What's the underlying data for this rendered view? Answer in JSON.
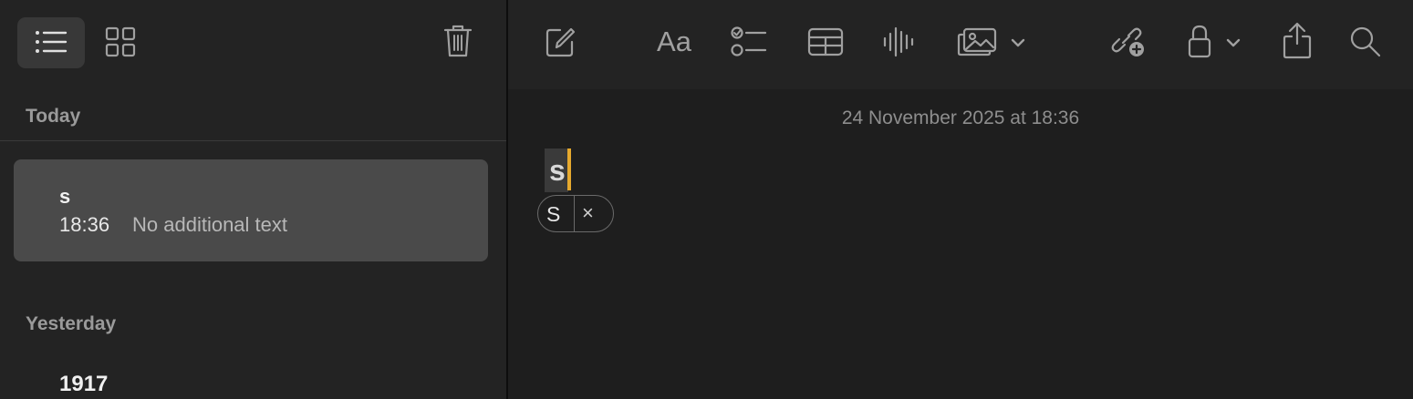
{
  "sidebar": {
    "toolbar": {
      "list_view_icon": "list-icon",
      "gallery_view_icon": "grid-icon",
      "delete_icon": "trash-icon"
    },
    "sections": [
      {
        "header": "Today",
        "notes": [
          {
            "title": "s",
            "time": "18:36",
            "preview": "No additional text",
            "selected": true
          }
        ]
      },
      {
        "header": "Yesterday",
        "notes": [
          {
            "title": "1917"
          }
        ]
      }
    ]
  },
  "toolbar": {
    "items": [
      "compose-icon",
      "format-text-icon",
      "checklist-icon",
      "table-icon",
      "audio-waveform-icon",
      "media-icon",
      "collaborate-link-icon",
      "lock-icon",
      "share-icon",
      "search-icon"
    ],
    "format_label": "Aa"
  },
  "editor": {
    "date": "24 November 2025 at 18:36",
    "content": "s",
    "autocorrect_suggestion": "S",
    "autocorrect_dismiss": "×"
  },
  "colors": {
    "caret": "#e6a92e",
    "selected_note_bg": "#4a4a4a",
    "background": "#1e1e1e"
  }
}
